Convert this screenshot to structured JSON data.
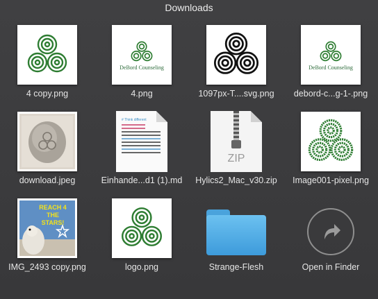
{
  "stack": {
    "title": "Downloads"
  },
  "items": [
    {
      "label": "4 copy.png",
      "kind": "triskele"
    },
    {
      "label": "4.png",
      "kind": "logo",
      "logo_text": "DeBord Counseling"
    },
    {
      "label": "1097px-T....svg.png",
      "kind": "triskele-black"
    },
    {
      "label": "debord-c...g-1-.png",
      "kind": "logo",
      "logo_text": "DeBord Counseling"
    },
    {
      "label": "download.jpeg",
      "kind": "photo-stone"
    },
    {
      "label": "Einhande...d1 (1).md",
      "kind": "markdown-doc",
      "doc_heading": "# Think different"
    },
    {
      "label": "Hylics2_Mac_v30.zip",
      "kind": "zip",
      "zip_text": "ZIP"
    },
    {
      "label": "Image001-pixel.png",
      "kind": "triskele-pixel"
    },
    {
      "label": "IMG_2493 copy.png",
      "kind": "photo-poster",
      "poster_text": "REACH 4 THE STARS!"
    },
    {
      "label": "logo.png",
      "kind": "triskele"
    },
    {
      "label": "Strange-Flesh",
      "kind": "folder"
    },
    {
      "label": "Open in Finder",
      "kind": "finder",
      "icon": "arrow-curved-icon"
    }
  ],
  "colors": {
    "spiral_green": "#2e7d32",
    "folder_blue": "#4aa3dc"
  }
}
